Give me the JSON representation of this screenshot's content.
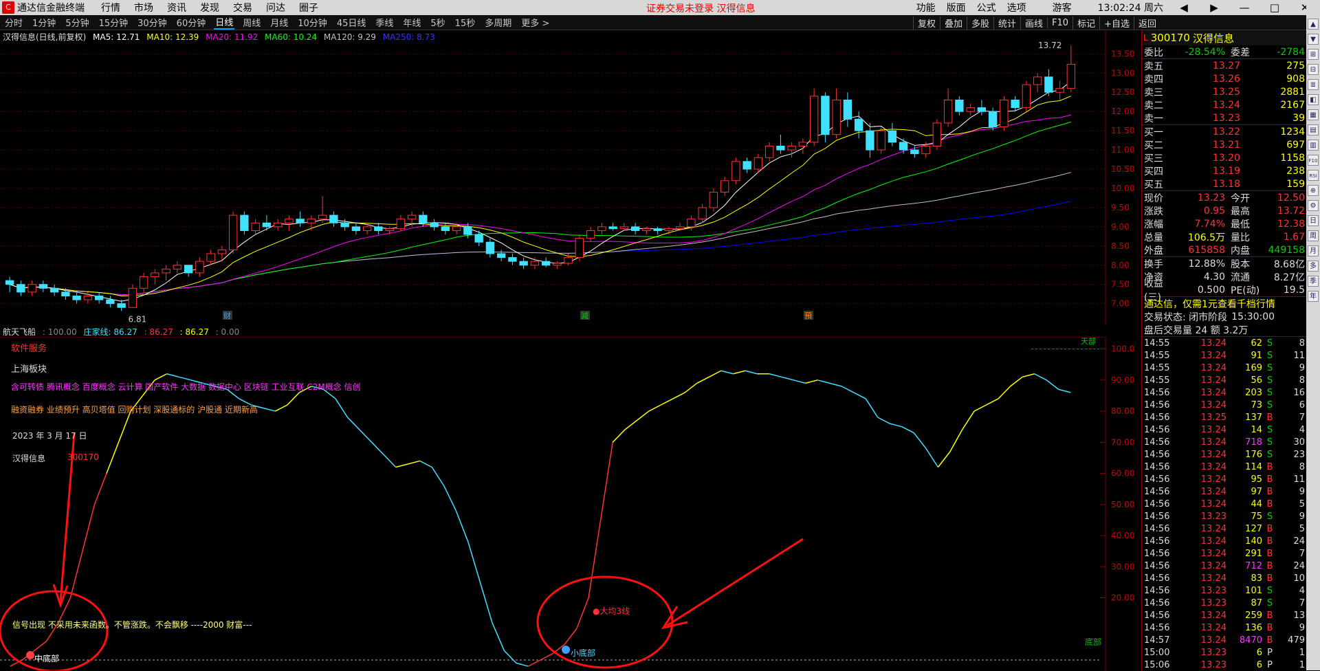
{
  "titlebar": {
    "app_name": "通达信金融终端",
    "menus": [
      "行情",
      "市场",
      "资讯",
      "发现",
      "交易",
      "问达",
      "圈子"
    ],
    "center_text": "证券交易未登录  汉得信息",
    "right_items": [
      "功能",
      "版面",
      "公式",
      "选项"
    ],
    "user": "游客",
    "clock": "13:02:24 周六",
    "win_buttons": [
      "◀",
      "▶",
      "—",
      "□",
      "✕"
    ]
  },
  "periods": {
    "items": [
      "分时",
      "1分钟",
      "5分钟",
      "15分钟",
      "30分钟",
      "60分钟",
      "日线",
      "周线",
      "月线",
      "10分钟",
      "45日线",
      "季线",
      "年线",
      "5秒",
      "15秒",
      "多周期",
      "更多 >"
    ],
    "selected": "日线"
  },
  "tools": [
    "复权",
    "叠加",
    "多股",
    "统计",
    "画线",
    "F10",
    "标记",
    "+自选",
    "返回"
  ],
  "main_info": {
    "title": "汉得信息(日线,前复权)",
    "ma5": "MA5: 12.71",
    "ma10": "MA10: 12.39",
    "ma20": "MA20: 11.92",
    "ma60": "MA60: 10.24",
    "ma120": "MA120: 9.29",
    "ma250": "MA250: 8.73",
    "high_label": "13.72",
    "low_label": "6.81",
    "events": [
      "财",
      "減",
      "預"
    ]
  },
  "colors": {
    "ma5": "#ffffff",
    "ma10": "#ffff00",
    "ma20": "#ff00ff",
    "ma60": "#00ff00",
    "ma120": "#c0c0c0",
    "ma250": "#0000ff",
    "up": "#ff3333",
    "down": "#40e0ff",
    "axis_line": "#800000"
  },
  "chart_data": [
    {
      "type": "candlestick",
      "yaxis_ticks": [
        "13.50",
        "13.00",
        "12.50",
        "12.00",
        "11.50",
        "11.00",
        "10.50",
        "10.00",
        "9.50",
        "9.00",
        "8.50",
        "8.00",
        "7.50",
        "7.00"
      ],
      "ylim": [
        6.6,
        13.9
      ],
      "candles": [
        [
          7.6,
          7.7,
          7.3,
          7.5
        ],
        [
          7.5,
          7.6,
          7.2,
          7.3
        ],
        [
          7.3,
          7.6,
          7.2,
          7.5
        ],
        [
          7.5,
          7.6,
          7.3,
          7.4
        ],
        [
          7.4,
          7.5,
          7.2,
          7.3
        ],
        [
          7.3,
          7.4,
          7.1,
          7.2
        ],
        [
          7.2,
          7.3,
          7.0,
          7.1
        ],
        [
          7.1,
          7.3,
          7.0,
          7.2
        ],
        [
          7.2,
          7.3,
          7.0,
          7.1
        ],
        [
          7.1,
          7.2,
          6.9,
          7.0
        ],
        [
          7.0,
          7.1,
          6.81,
          6.9
        ],
        [
          6.9,
          7.5,
          6.9,
          7.4
        ],
        [
          7.4,
          7.8,
          7.3,
          7.7
        ],
        [
          7.7,
          7.9,
          7.5,
          7.8
        ],
        [
          7.8,
          8.0,
          7.6,
          7.9
        ],
        [
          7.9,
          8.1,
          7.8,
          8.0
        ],
        [
          8.0,
          8.0,
          7.7,
          7.8
        ],
        [
          7.8,
          8.2,
          7.7,
          8.1
        ],
        [
          8.1,
          8.4,
          8.0,
          8.3
        ],
        [
          8.3,
          8.5,
          8.1,
          8.4
        ],
        [
          8.4,
          9.4,
          8.3,
          9.3
        ],
        [
          9.3,
          9.4,
          8.8,
          8.9
        ],
        [
          8.9,
          9.2,
          8.8,
          9.1
        ],
        [
          9.1,
          9.3,
          8.9,
          9.0
        ],
        [
          9.0,
          9.2,
          8.9,
          9.1
        ],
        [
          9.1,
          9.3,
          8.9,
          9.2
        ],
        [
          9.2,
          9.4,
          9.0,
          9.1
        ],
        [
          9.1,
          9.3,
          8.9,
          9.2
        ],
        [
          9.2,
          9.8,
          9.1,
          9.3
        ],
        [
          9.3,
          9.4,
          9.0,
          9.1
        ],
        [
          9.1,
          9.2,
          8.9,
          9.0
        ],
        [
          9.0,
          9.1,
          8.8,
          8.9
        ],
        [
          8.9,
          9.1,
          8.8,
          9.0
        ],
        [
          9.0,
          9.1,
          8.8,
          8.9
        ],
        [
          8.9,
          9.0,
          8.8,
          8.95
        ],
        [
          8.95,
          9.3,
          8.9,
          9.2
        ],
        [
          9.2,
          9.4,
          9.0,
          9.3
        ],
        [
          9.3,
          9.4,
          9.0,
          9.1
        ],
        [
          9.1,
          9.2,
          8.9,
          9.0
        ],
        [
          9.0,
          9.1,
          8.8,
          8.9
        ],
        [
          8.9,
          9.1,
          8.8,
          9.0
        ],
        [
          9.0,
          9.1,
          8.7,
          8.8
        ],
        [
          8.8,
          8.9,
          8.5,
          8.6
        ],
        [
          8.6,
          8.7,
          8.2,
          8.3
        ],
        [
          8.3,
          8.4,
          8.1,
          8.2
        ],
        [
          8.2,
          8.3,
          8.0,
          8.1
        ],
        [
          8.1,
          8.2,
          7.9,
          8.0
        ],
        [
          8.0,
          8.2,
          7.9,
          8.1
        ],
        [
          8.1,
          8.2,
          7.95,
          8.0
        ],
        [
          8.0,
          8.1,
          7.9,
          8.05
        ],
        [
          8.05,
          8.3,
          8.0,
          8.2
        ],
        [
          8.2,
          8.8,
          8.1,
          8.7
        ],
        [
          8.7,
          9.0,
          8.6,
          8.9
        ],
        [
          8.9,
          9.1,
          8.8,
          9.0
        ],
        [
          9.0,
          9.1,
          8.9,
          8.95
        ],
        [
          8.95,
          9.1,
          8.9,
          9.0
        ],
        [
          9.0,
          9.1,
          8.8,
          8.9
        ],
        [
          8.9,
          9.0,
          8.8,
          8.95
        ],
        [
          8.95,
          9.0,
          8.8,
          8.9
        ],
        [
          8.9,
          9.0,
          8.8,
          8.95
        ],
        [
          8.95,
          9.1,
          8.9,
          9.0
        ],
        [
          9.0,
          9.3,
          8.9,
          9.2
        ],
        [
          9.2,
          9.6,
          9.1,
          9.5
        ],
        [
          9.5,
          10.0,
          9.4,
          9.9
        ],
        [
          9.9,
          10.3,
          9.8,
          10.2
        ],
        [
          10.2,
          10.8,
          10.1,
          10.7
        ],
        [
          10.7,
          10.8,
          10.4,
          10.5
        ],
        [
          10.5,
          10.9,
          10.4,
          10.8
        ],
        [
          10.8,
          11.2,
          10.7,
          11.1
        ],
        [
          11.1,
          11.4,
          10.9,
          11.0
        ],
        [
          11.0,
          11.2,
          10.8,
          11.1
        ],
        [
          11.1,
          11.3,
          10.9,
          11.2
        ],
        [
          11.2,
          12.6,
          11.1,
          12.4
        ],
        [
          12.4,
          12.5,
          11.2,
          11.4
        ],
        [
          11.4,
          12.6,
          11.3,
          12.3
        ],
        [
          12.3,
          12.5,
          11.6,
          11.8
        ],
        [
          11.8,
          12.0,
          11.3,
          11.5
        ],
        [
          11.5,
          11.7,
          10.8,
          11.0
        ],
        [
          11.0,
          11.6,
          10.9,
          11.5
        ],
        [
          11.5,
          11.7,
          11.1,
          11.2
        ],
        [
          11.2,
          11.3,
          10.9,
          11.0
        ],
        [
          11.0,
          11.1,
          10.8,
          10.9
        ],
        [
          10.9,
          11.2,
          10.8,
          11.1
        ],
        [
          11.1,
          11.8,
          11.0,
          11.7
        ],
        [
          11.7,
          12.6,
          11.6,
          12.3
        ],
        [
          12.3,
          12.4,
          11.9,
          12.0
        ],
        [
          12.0,
          12.2,
          11.9,
          12.1
        ],
        [
          12.1,
          12.3,
          11.9,
          12.0
        ],
        [
          12.0,
          12.1,
          11.5,
          11.6
        ],
        [
          11.6,
          12.4,
          11.5,
          12.3
        ],
        [
          12.3,
          12.4,
          12.0,
          12.1
        ],
        [
          12.1,
          12.8,
          12.0,
          12.7
        ],
        [
          12.7,
          13.0,
          12.5,
          12.9
        ],
        [
          12.9,
          13.1,
          12.4,
          12.5
        ],
        [
          12.5,
          12.8,
          12.3,
          12.6
        ],
        [
          12.6,
          13.72,
          12.5,
          13.23
        ]
      ]
    },
    {
      "type": "line",
      "name": "庄家线",
      "yaxis_ticks": [
        "100.0",
        "90.00",
        "80.00",
        "70.00",
        "60.00",
        "50.00",
        "40.00",
        "30.00",
        "20.00"
      ],
      "ylim": [
        0,
        103
      ],
      "values": [
        -2,
        0,
        3,
        6,
        12,
        20,
        35,
        50,
        60,
        70,
        80,
        85,
        90,
        92,
        91,
        90,
        89,
        88,
        87,
        84,
        82,
        81,
        80,
        82,
        86,
        88,
        87,
        84,
        78,
        74,
        70,
        66,
        62,
        63,
        64,
        62,
        56,
        48,
        38,
        25,
        12,
        3,
        -1,
        -2,
        0,
        2,
        5,
        10,
        20,
        45,
        70,
        74,
        77,
        80,
        82,
        84,
        86,
        89,
        91,
        93,
        92,
        93,
        92,
        92,
        91,
        90,
        89,
        90,
        89,
        88,
        86,
        84,
        78,
        76,
        75,
        73,
        68,
        62,
        67,
        74,
        80,
        82,
        84,
        88,
        91,
        92,
        90,
        87,
        86
      ],
      "color_rising": "#ff3333",
      "color_high": "#ffff00",
      "color_falling": "#40e0ff"
    }
  ],
  "sub_info": {
    "title": "航天飞船",
    "v1": ": 100.00",
    "line_label": "庄家线: 86.27",
    "v2": ": 86.27",
    "v3": ": 86.27",
    "v4": ": 0.00"
  },
  "sub_overlay": {
    "l1": "软件服务",
    "l2": "上海板块",
    "l3": "含可转债 腾讯概念 百度概念 云计算 国产软件 大数据 数据中心 区块链 工业互联 C2M概念 信创",
    "l4": "融资融券 业绩预升 高贝塔值 回购计划 深股通标的 沪股通 近期新高",
    "l5": "2023 年 3 月 17 日",
    "stock_name": "汉得信息",
    "stock_code": "300170",
    "note": "信号出现  不采用未来函数。不管涨跌。不会飘移 ----2000 财富---",
    "mark_a": "中底部",
    "mark_b": "小底部",
    "mark_c": "●大均3线",
    "label_top": "天部",
    "label_bottom": "底部"
  },
  "quote": {
    "code": "300170",
    "name": "汉得信息",
    "weibi_label": "委比",
    "weibi_val": "-28.54%",
    "weicha_label": "委差",
    "weicha_val": "-2784",
    "sells": [
      {
        "l": "卖五",
        "p": "13.27",
        "v": "275"
      },
      {
        "l": "卖四",
        "p": "13.26",
        "v": "908"
      },
      {
        "l": "卖三",
        "p": "13.25",
        "v": "2881"
      },
      {
        "l": "卖二",
        "p": "13.24",
        "v": "2167"
      },
      {
        "l": "卖一",
        "p": "13.23",
        "v": "39"
      }
    ],
    "buys": [
      {
        "l": "买一",
        "p": "13.22",
        "v": "1234"
      },
      {
        "l": "买二",
        "p": "13.21",
        "v": "697"
      },
      {
        "l": "买三",
        "p": "13.20",
        "v": "1158"
      },
      {
        "l": "买四",
        "p": "13.19",
        "v": "238"
      },
      {
        "l": "买五",
        "p": "13.18",
        "v": "159"
      }
    ],
    "stats": [
      {
        "a": "现价",
        "b": "13.23",
        "bc": "red",
        "c": "今开",
        "d": "12.50",
        "dc": "red"
      },
      {
        "a": "涨跌",
        "b": "0.95",
        "bc": "red",
        "c": "最高",
        "d": "13.72",
        "dc": "red"
      },
      {
        "a": "涨幅",
        "b": "7.74%",
        "bc": "red",
        "c": "最低",
        "d": "12.38",
        "dc": "red"
      },
      {
        "a": "总量",
        "b": "106.5万",
        "bc": "yel",
        "c": "量比",
        "d": "1.67",
        "dc": "red"
      },
      {
        "a": "外盘",
        "b": "615858",
        "bc": "red",
        "c": "内盘",
        "d": "449158",
        "dc": "grn"
      }
    ],
    "stats2": [
      {
        "a": "换手",
        "b": "12.88%",
        "c": "股本",
        "d": "8.68亿"
      },
      {
        "a": "净资",
        "b": "4.30",
        "c": "流通",
        "d": "8.27亿"
      },
      {
        "a": "收益(三)",
        "b": "0.500",
        "c": "PE(动)",
        "d": "19.5"
      }
    ],
    "ad": "通达信，仅需1元查看千档行情",
    "status_label": "交易状态: 闭市阶段",
    "status_time": "15:30:00",
    "after": "盘后交易量 24 额 3.2万"
  },
  "ticks": [
    [
      "14:55",
      "13.24",
      "62",
      "S",
      "8"
    ],
    [
      "14:55",
      "13.24",
      "91",
      "S",
      "11"
    ],
    [
      "14:55",
      "13.24",
      "169",
      "S",
      "9"
    ],
    [
      "14:55",
      "13.24",
      "56",
      "S",
      "8"
    ],
    [
      "14:56",
      "13.24",
      "203",
      "S",
      "16"
    ],
    [
      "14:56",
      "13.24",
      "73",
      "S",
      "6"
    ],
    [
      "14:56",
      "13.25",
      "137",
      "B",
      "7"
    ],
    [
      "14:56",
      "13.24",
      "14",
      "S",
      "4"
    ],
    [
      "14:56",
      "13.24",
      "718",
      "S",
      "30"
    ],
    [
      "14:56",
      "13.24",
      "176",
      "S",
      "23"
    ],
    [
      "14:56",
      "13.24",
      "114",
      "B",
      "8"
    ],
    [
      "14:56",
      "13.24",
      "95",
      "B",
      "11"
    ],
    [
      "14:56",
      "13.24",
      "97",
      "B",
      "9"
    ],
    [
      "14:56",
      "13.24",
      "44",
      "B",
      "5"
    ],
    [
      "14:56",
      "13.23",
      "75",
      "S",
      "9"
    ],
    [
      "14:56",
      "13.24",
      "127",
      "B",
      "5"
    ],
    [
      "14:56",
      "13.24",
      "140",
      "B",
      "24"
    ],
    [
      "14:56",
      "13.24",
      "291",
      "B",
      "7"
    ],
    [
      "14:56",
      "13.24",
      "712",
      "B",
      "24"
    ],
    [
      "14:56",
      "13.24",
      "83",
      "B",
      "10"
    ],
    [
      "14:56",
      "13.23",
      "101",
      "S",
      "4"
    ],
    [
      "14:56",
      "13.23",
      "87",
      "S",
      "7"
    ],
    [
      "14:56",
      "13.24",
      "259",
      "B",
      "13"
    ],
    [
      "14:56",
      "13.24",
      "136",
      "B",
      "9"
    ],
    [
      "14:57",
      "13.24",
      "8470",
      "B",
      "479"
    ],
    [
      "15:00",
      "13.23",
      "6",
      "P",
      "1"
    ],
    [
      "15:06",
      "13.23",
      "6",
      "P",
      "1"
    ]
  ],
  "side_icons": [
    "▲",
    "▼",
    "⊞",
    "⊟",
    "≣",
    "◧",
    "▦",
    "▤",
    "▥",
    "F10",
    "RSI",
    "⊕",
    "⚙",
    "日",
    "周",
    "月",
    "多",
    "季",
    "年"
  ]
}
